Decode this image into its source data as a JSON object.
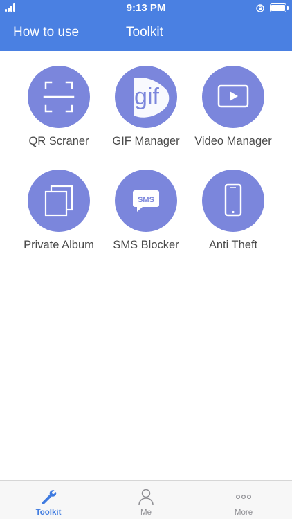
{
  "status_bar": {
    "time": "9:13 PM"
  },
  "nav": {
    "left_link": "How to use",
    "title": "Toolkit"
  },
  "tools": [
    {
      "label": "QR Scraner",
      "icon": "qr-scanner-icon"
    },
    {
      "label": "GIF Manager",
      "icon": "gif-icon",
      "icon_text": "gif"
    },
    {
      "label": "Video Manager",
      "icon": "video-player-icon"
    },
    {
      "label": "Private Album",
      "icon": "album-stack-icon"
    },
    {
      "label": "SMS Blocker",
      "icon": "sms-bubble-icon",
      "icon_text": "SMS"
    },
    {
      "label": "Anti Theft",
      "icon": "smartphone-icon"
    }
  ],
  "tabbar": {
    "items": [
      {
        "label": "Toolkit",
        "icon": "wrench-icon",
        "active": true
      },
      {
        "label": "Me",
        "icon": "person-icon",
        "active": false
      },
      {
        "label": "More",
        "icon": "more-dots-icon",
        "active": false
      }
    ]
  },
  "colors": {
    "header": "#4a80e2",
    "tool_circle": "#7b86dc",
    "tab_active": "#3f7be0",
    "tab_inactive": "#8e8e93"
  }
}
